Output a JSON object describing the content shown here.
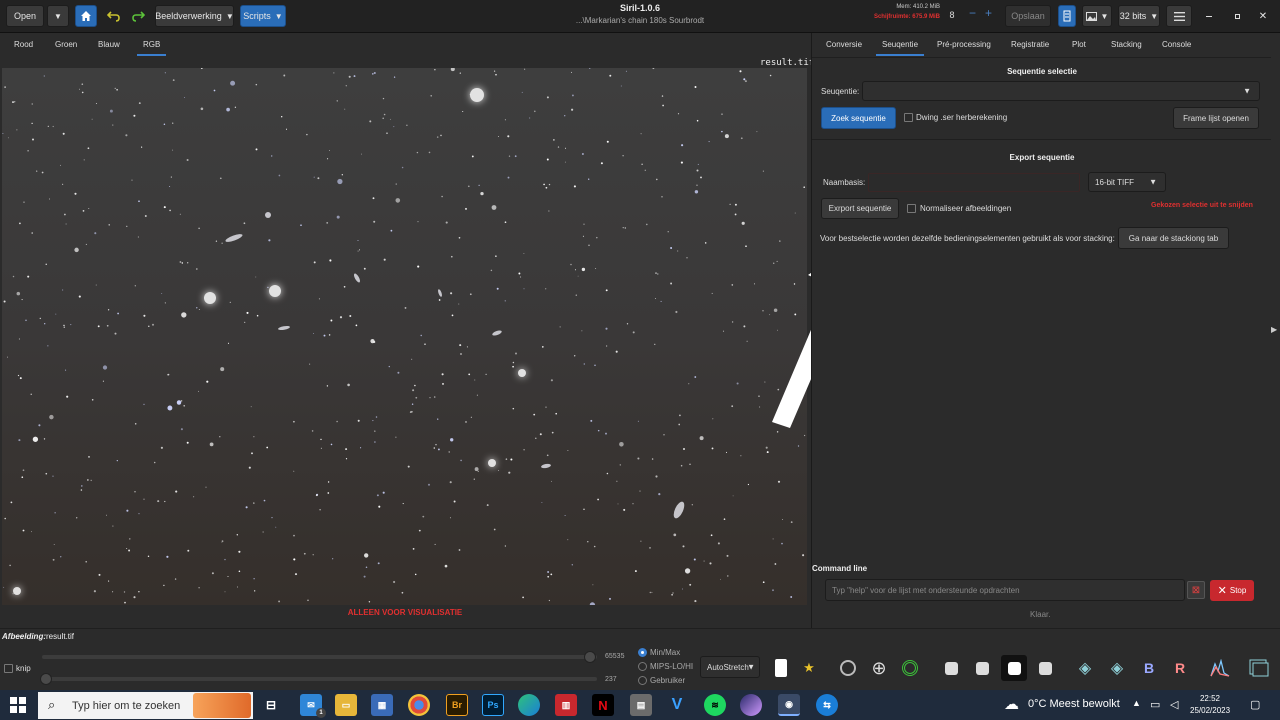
{
  "header": {
    "open_label": "Open",
    "image_processing_label": "Beeldverwerking",
    "scripts_label": "Scripts",
    "title": "Siril-1.0.6",
    "subtitle": "...\\Markarian's chain 180s Sourbrodt",
    "memory": "Mem: 410.2 MiB",
    "disk_free": "Schijfruimte: 675.9 MiB",
    "threads": "8",
    "save_label": "Opslaan",
    "bitdepth": "32 bits",
    "minus_icon": "−",
    "plus_icon": "+"
  },
  "left_tabs": [
    "Rood",
    "Groen",
    "Blauw",
    "RGB"
  ],
  "image": {
    "filename": "result.tif",
    "visualisation_label": "ALLEEN VOOR VISUALISATIE"
  },
  "right_tabs": [
    "Conversie",
    "Seuqentie",
    "Pré-processing",
    "Registratie",
    "Plot",
    "Stacking",
    "Console"
  ],
  "sequence": {
    "section_title": "Sequentie selectie",
    "sequence_label": "Seuqentie:",
    "search_button": "Zoek sequentie",
    "force_checkbox": "Dwing .ser herberekening",
    "frame_list_button": "Frame lijst openen"
  },
  "export": {
    "section_title": "Export sequentie",
    "basename_label": "Naambasis:",
    "format": "16-bit TIFF",
    "export_button": "Exrport sequentie",
    "normalise_checkbox": "Normaliseer afbeeldingen",
    "crop_warning": "Gekozen selectie uit te snijden",
    "info_text": "Voor bestselectie worden dezelfde bedieningselementen gebruikt als voor stacking:",
    "goto_stacking_button": "Ga naar de stackiong tab"
  },
  "command": {
    "label": "Command line",
    "placeholder": "Typ \"help\" voor de lijst met ondersteunde opdrachten",
    "stop_label": "Stop",
    "status": "Klaar."
  },
  "bottom": {
    "image_label": "Afbeelding:",
    "image_value": "result.tif",
    "crop_checkbox": "knip",
    "max_value": "65535",
    "min_value": "237",
    "radio_options": [
      "Min/Max",
      "MIPS-LO/HI",
      "Gebruiker"
    ],
    "stretch": "AutoStretch"
  },
  "taskbar": {
    "search_placeholder": "Typ hier om te zoeken",
    "weather": "0°C  Meest bewolkt",
    "time": "22:52",
    "date": "25/02/2023",
    "badge": "1"
  },
  "colors": {
    "accent": "#2a6db8",
    "warning": "#e03030",
    "stop": "#c8282e"
  }
}
